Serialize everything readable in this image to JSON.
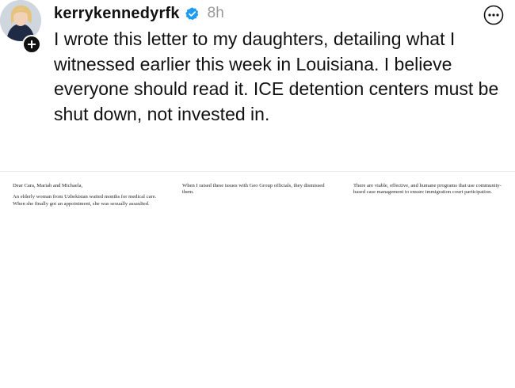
{
  "post": {
    "username": "kerrykennedyrfk",
    "timestamp": "8h",
    "caption": "I wrote this letter to my daughters, detailing what I witnessed earlier this week in Louisiana. I believe everyone should read it. ICE detention centers must be shut down, not invested in.",
    "icons": {
      "avatar": "avatar",
      "follow": "plus-icon",
      "verified": "verified-badge-icon",
      "more": "more-icon"
    },
    "colors": {
      "verified": "#1d9bf0",
      "follow_badge": "#111111",
      "timestamp": "#9a9a9a"
    }
  },
  "letter": {
    "columns": [
      {
        "paragraphs": [
          "Dear Cara, Mariah and Michaela,",
          "An elderly woman from Uzbekistan waited months for medical care. When she finally got an appointment, she was sexually assaulted."
        ]
      },
      {
        "paragraphs": [
          "When I raised these issues with Geo Group officials, they dismissed them."
        ]
      },
      {
        "paragraphs": [
          "There are viable, effective, and humane programs that use community-based case management to ensure immigration court participation."
        ]
      }
    ]
  }
}
